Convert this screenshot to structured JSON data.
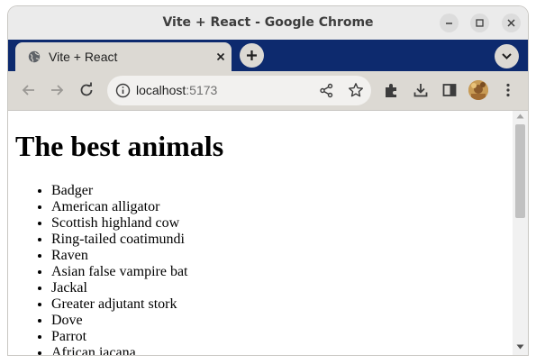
{
  "window": {
    "title": "Vite + React - Google Chrome"
  },
  "tab": {
    "title": "Vite + React"
  },
  "address_bar": {
    "host": "localhost",
    "port": ":5173"
  },
  "page": {
    "heading": "The best animals",
    "animals": [
      "Badger",
      "American alligator",
      "Scottish highland cow",
      "Ring-tailed coatimundi",
      "Raven",
      "Asian false vampire bat",
      "Jackal",
      "Greater adjutant stork",
      "Dove",
      "Parrot",
      "African jacana"
    ]
  },
  "colors": {
    "tab_strip": "#0d2a6e",
    "toolbar": "#dcd9d3",
    "title_bar": "#ebebeb"
  }
}
